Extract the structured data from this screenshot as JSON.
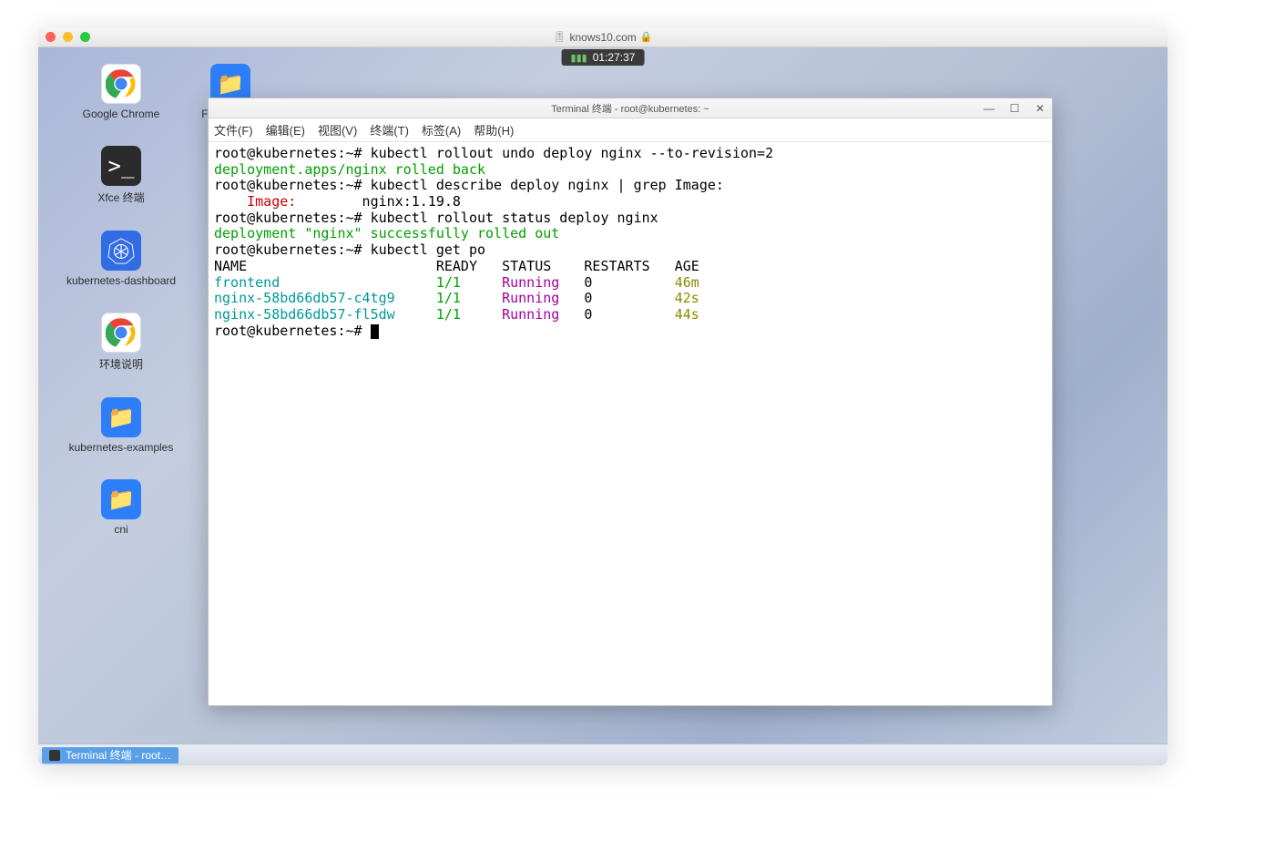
{
  "browser": {
    "url": "knows10.com",
    "lock_glyph": "🔒",
    "tune_glyph": "🎚"
  },
  "timer": {
    "value": "01:27:37",
    "signal_glyph": "▮▮▮"
  },
  "desktop": {
    "items": [
      {
        "label": "Google Chrome",
        "kind": "chrome"
      },
      {
        "label": "FileTransfer",
        "kind": "folder"
      },
      {
        "label": "Xfce 终端",
        "kind": "term"
      },
      {
        "label": "kubernetes-dashboard",
        "kind": "k8s"
      },
      {
        "label": "环境说明",
        "kind": "chrome"
      },
      {
        "label": "kubernetes-examples",
        "kind": "folder"
      },
      {
        "label": "cni",
        "kind": "folder"
      }
    ]
  },
  "terminal": {
    "title": "Terminal 终端 - root@kubernetes: ~",
    "menus": [
      "文件(F)",
      "编辑(E)",
      "视图(V)",
      "终端(T)",
      "标签(A)",
      "帮助(H)"
    ],
    "prompt": "root@kubernetes:~# ",
    "cmd1": "kubectl rollout undo deploy nginx --to-revision=2",
    "out1": "deployment.apps/nginx rolled back",
    "cmd2": "kubectl describe deploy nginx | grep Image:",
    "out2_label": "    Image:",
    "out2_value": "        nginx:1.19.8",
    "cmd3": "kubectl rollout status deploy nginx",
    "out3": "deployment \"nginx\" successfully rolled out",
    "cmd4": "kubectl get po",
    "table_header": "NAME                       READY   STATUS    RESTARTS   AGE",
    "rows": [
      {
        "name": "frontend                 ",
        "ready": "  1/1   ",
        "status": "  Running",
        "restarts": "   0          ",
        "age": "46m"
      },
      {
        "name": "nginx-58bd66db57-c4tg9   ",
        "ready": "  1/1   ",
        "status": "  Running",
        "restarts": "   0          ",
        "age": "42s"
      },
      {
        "name": "nginx-58bd66db57-fl5dw   ",
        "ready": "  1/1   ",
        "status": "  Running",
        "restarts": "   0          ",
        "age": "44s"
      }
    ]
  },
  "taskbar": {
    "item0": "Terminal 终端 - root…"
  }
}
